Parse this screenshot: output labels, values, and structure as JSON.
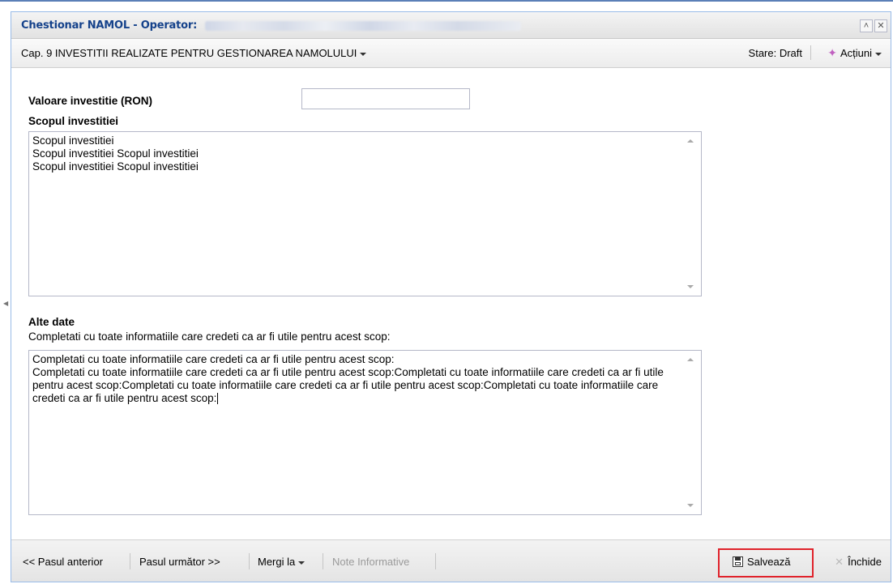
{
  "window": {
    "title": "Chestionar NAMOL - Operator:",
    "collapse_icon": "double-chevron-up-icon",
    "close_icon": "close-icon"
  },
  "toolbar": {
    "chapter": "Cap. 9 INVESTITII REALIZATE PENTRU GESTIONAREA NAMOLULUI",
    "status": "Stare: Draft",
    "actions": "Acțiuni"
  },
  "form": {
    "investment_value_label": "Valoare investitie (RON)",
    "investment_value": "",
    "purpose_label": "Scopul investitiei",
    "purpose_lines": [
      "Scopul investitiei",
      "Scopul investitiei Scopul investitiei",
      "Scopul investitiei Scopul investitiei"
    ],
    "other_label": "Alte date",
    "other_hint": "Completati cu toate informatiile care credeti ca ar fi utile pentru acest scop:",
    "other_lines": [
      "Completati cu toate informatiile care credeti ca ar fi utile pentru acest scop:",
      "Completati cu toate informatiile care credeti ca ar fi utile pentru acest scop:Completati cu toate informatiile care credeti ca ar fi utile pentru acest scop:Completati cu toate informatiile care credeti ca ar fi utile pentru acest scop:Completati cu toate informatiile care credeti ca ar fi utile pentru acest scop:"
    ]
  },
  "footer": {
    "prev": "<< Pasul anterior",
    "next": "Pasul următor >>",
    "goto": "Mergi la",
    "notes": "Note Informative",
    "save": "Salvează",
    "close": "Închide"
  },
  "colors": {
    "title_text": "#15428b",
    "border": "#99bbe8",
    "highlight": "#e0222b"
  }
}
